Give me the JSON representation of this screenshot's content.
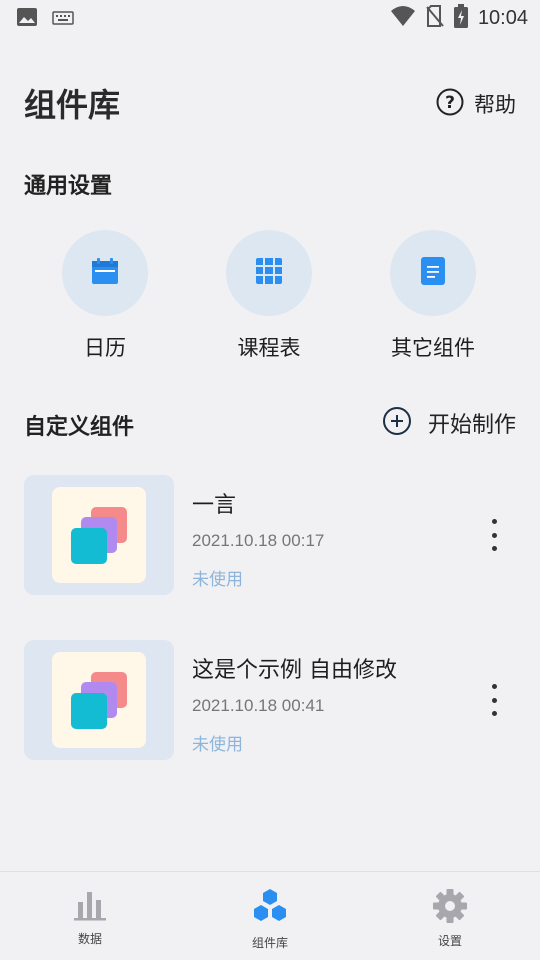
{
  "status_bar": {
    "time": "10:04",
    "icons": [
      "image-icon",
      "keyboard-icon",
      "wifi-icon",
      "no-sim-icon",
      "battery-charging-icon"
    ]
  },
  "header": {
    "title": "组件库",
    "help_label": "帮助",
    "help_icon": "help-circle-icon"
  },
  "general": {
    "section_title": "通用设置",
    "items": [
      {
        "label": "日历",
        "icon": "calendar-icon"
      },
      {
        "label": "课程表",
        "icon": "timetable-icon"
      },
      {
        "label": "其它组件",
        "icon": "document-icon"
      }
    ]
  },
  "custom": {
    "section_title": "自定义组件",
    "start_label": "开始制作",
    "start_icon": "add-circle-icon",
    "cards": [
      {
        "title": "一言",
        "time": "2021.10.18 00:17",
        "status": "未使用"
      },
      {
        "title": "这是个示例 自由修改",
        "time": "2021.10.18 00:41",
        "status": "未使用"
      }
    ]
  },
  "bottom_nav": {
    "items": [
      {
        "label": "数据",
        "icon": "bar-chart-icon"
      },
      {
        "label": "组件库",
        "icon": "hexagons-icon",
        "active": true
      },
      {
        "label": "设置",
        "icon": "gear-icon"
      }
    ]
  },
  "colors": {
    "accent": "#2a8ff0",
    "background": "#f1f1f4",
    "widget_circle": "#dde7f1",
    "status_text": "#8db5db",
    "layer_pink": "#f58a8a",
    "layer_purple": "#b18af0",
    "layer_cyan": "#13bcd2"
  }
}
